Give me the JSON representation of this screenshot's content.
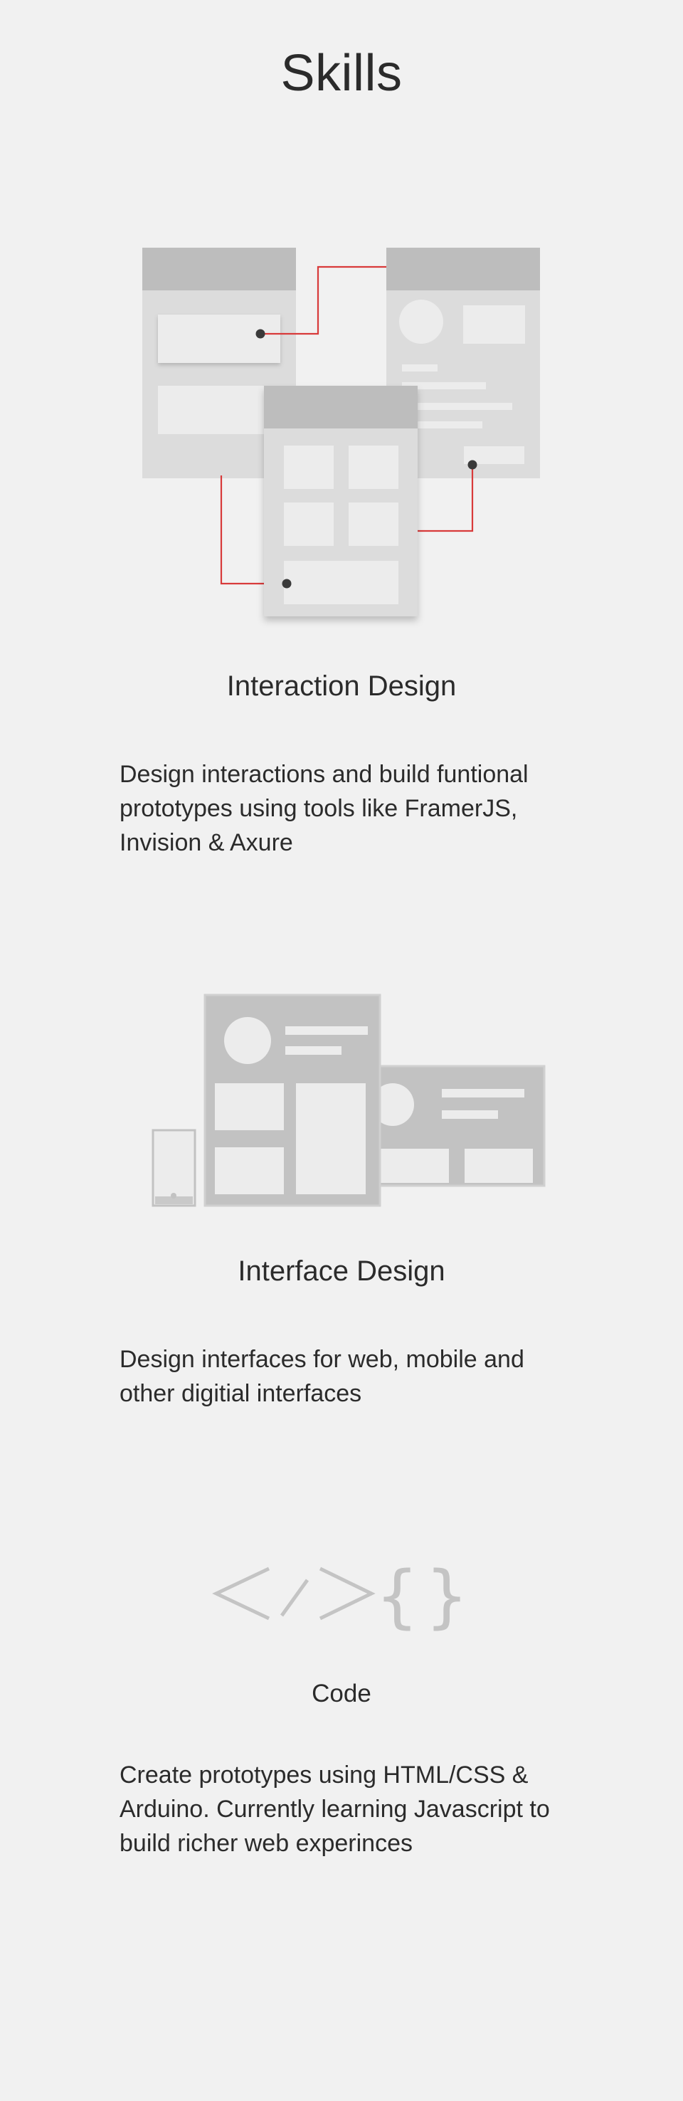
{
  "page": {
    "title": "Skills",
    "background": "#f1f1f1",
    "accent_color": "#d83a3a"
  },
  "skills": [
    {
      "heading": "Interaction Design",
      "description": "Design interactions and build funtional prototypes using tools like FramerJS, Invision & Axure",
      "illustration": "wireframe-flow-icon"
    },
    {
      "heading": "Interface Design",
      "description": "Design interfaces for web, mobile and other digitial interfaces",
      "illustration": "multi-device-layout-icon"
    },
    {
      "heading": "Code",
      "description": "Create prototypes using HTML/CSS & Arduino. Currently learning Javascript to build richer web experinces",
      "illustration": "code-brackets-icon"
    }
  ]
}
